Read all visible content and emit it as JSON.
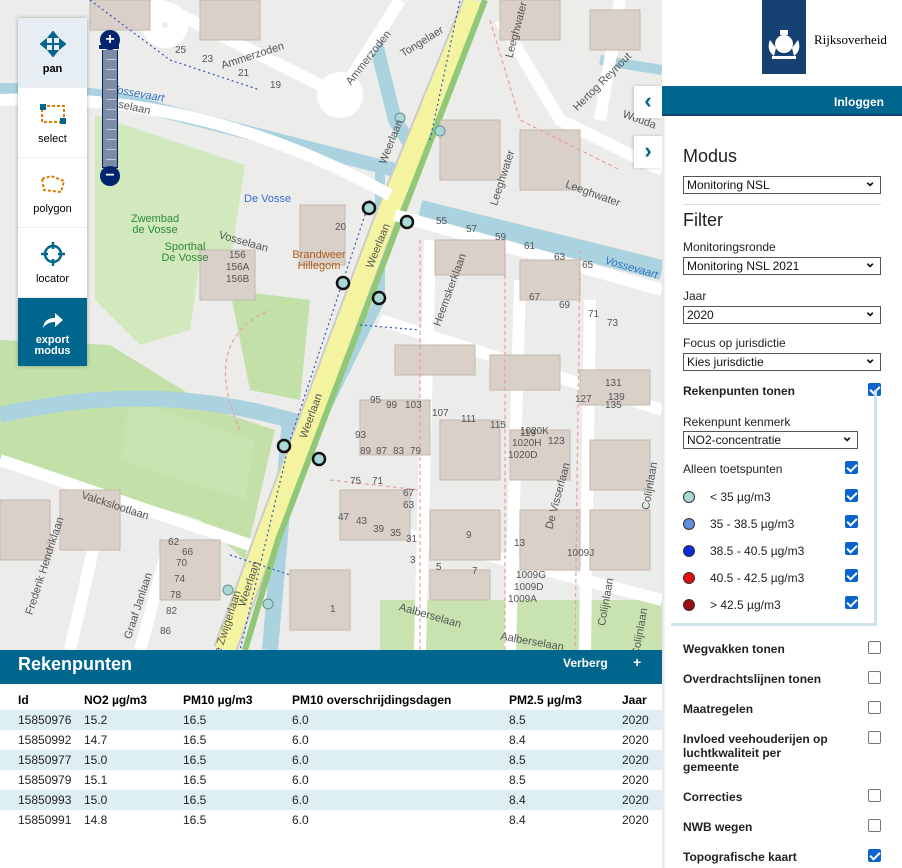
{
  "toolbar": {
    "tools": [
      {
        "key": "pan",
        "label": "pan"
      },
      {
        "key": "select",
        "label": "select"
      },
      {
        "key": "polygon",
        "label": "polygon"
      },
      {
        "key": "locator",
        "label": "locator"
      }
    ],
    "export_label_1": "export",
    "export_label_2": "modus"
  },
  "zoom": {
    "in": "+",
    "out": "−"
  },
  "map": {
    "streets": [
      "Ammerzoden",
      "Ammerzoden",
      "Tongelaer",
      "Leeghwater",
      "Hertog Reynout",
      "Vosselaan",
      "Weerlaan",
      "Weerlaan",
      "Weerlaan",
      "Weerlaan",
      "Vosselaan",
      "Vossevaart",
      "Heemskerklaan",
      "Leeghwater",
      "Leeghwater",
      "Valckslootlaan",
      "Frederik Hendriklaan",
      "Graaf Janlaan",
      "De Zwijgerlaan",
      "Aalberselaan",
      "Aalberselaan",
      "De Visserlaan",
      "Colijnlaan",
      "Colijnlaan",
      "Colijnlaan",
      "Wouda",
      "Vossevaart"
    ],
    "pois": {
      "zwembad": "Zwembad de Vosse",
      "sporthal": "Sporthal De Vosse",
      "de_vosse": "De Vosse",
      "brandweer": "Brandweer Hillegom"
    },
    "house_numbers": [
      "20",
      "25",
      "23",
      "21",
      "19",
      "55",
      "57",
      "59",
      "61",
      "63",
      "65",
      "67",
      "69",
      "71",
      "73",
      "156",
      "156A",
      "156B",
      "95",
      "99",
      "103",
      "107",
      "111",
      "115",
      "119",
      "123",
      "127",
      "131",
      "135",
      "139",
      "93",
      "89",
      "87",
      "83",
      "79",
      "75",
      "71",
      "67",
      "63",
      "1020K",
      "1020H",
      "1020D",
      "1009J",
      "1009G",
      "1009D",
      "1009A",
      "13",
      "9",
      "7",
      "5",
      "3",
      "1",
      "47",
      "43",
      "39",
      "35",
      "31",
      "62",
      "66",
      "70",
      "74",
      "78",
      "82",
      "86"
    ],
    "accent": "#f4f4a0"
  },
  "user": {
    "login": "Inloggen",
    "logo_text": "Rijksoverheid"
  },
  "panel": {
    "modus_title": "Modus",
    "modus_value": "Monitoring NSL",
    "filter_title": "Filter",
    "ronde_label": "Monitoringsronde",
    "ronde_value": "Monitoring NSL 2021",
    "jaar_label": "Jaar",
    "jaar_value": "2020",
    "focus_label": "Focus op jurisdictie",
    "focus_value": "Kies jurisdictie",
    "rekenpunten_label": "Rekenpunten tonen",
    "kenmerk_label": "Rekenpunt kenmerk",
    "kenmerk_value": "NO2-concentratie",
    "toets_label": "Alleen toetspunten",
    "legend": [
      {
        "label": "< 35 µg/m3",
        "color": "#a8d8d8"
      },
      {
        "label": "35 - 38.5 µg/m3",
        "color": "#5f8fd8"
      },
      {
        "label": "38.5 - 40.5 µg/m3",
        "color": "#0a2bd8"
      },
      {
        "label": "40.5 - 42.5 µg/m3",
        "color": "#e01010"
      },
      {
        "label": "> 42.5 µg/m3",
        "color": "#9c0a14"
      }
    ],
    "layers": [
      {
        "label": "Wegvakken tonen",
        "checked": false
      },
      {
        "label": "Overdrachtslijnen tonen",
        "checked": false
      },
      {
        "label": "Maatregelen",
        "checked": false
      },
      {
        "label": "Invloed veehouderijen op luchtkwaliteit per gemeente",
        "checked": false
      },
      {
        "label": "Correcties",
        "checked": false
      },
      {
        "label": "NWB wegen",
        "checked": false
      },
      {
        "label": "Topografische kaart",
        "checked": true
      }
    ]
  },
  "results": {
    "title": "Rekenpunten",
    "hide": "Verberg",
    "expand": "+",
    "columns": [
      "Id",
      "NO2 µg/m3",
      "PM10 µg/m3",
      "PM10 overschrijdingsdagen",
      "PM2.5 µg/m3",
      "Jaar"
    ],
    "rows": [
      [
        "15850976",
        "15.2",
        "16.5",
        "6.0",
        "8.5",
        "2020"
      ],
      [
        "15850992",
        "14.7",
        "16.5",
        "6.0",
        "8.4",
        "2020"
      ],
      [
        "15850977",
        "15.0",
        "16.5",
        "6.0",
        "8.5",
        "2020"
      ],
      [
        "15850979",
        "15.1",
        "16.5",
        "6.0",
        "8.5",
        "2020"
      ],
      [
        "15850993",
        "15.0",
        "16.5",
        "6.0",
        "8.4",
        "2020"
      ],
      [
        "15850991",
        "14.8",
        "16.5",
        "6.0",
        "8.4",
        "2020"
      ]
    ]
  }
}
